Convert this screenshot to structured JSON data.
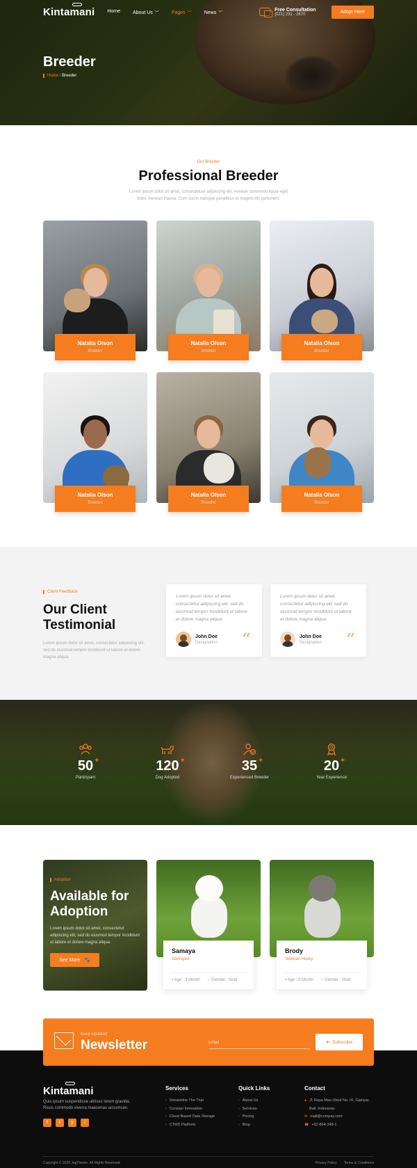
{
  "nav": {
    "logo": "Kintamani",
    "menu": [
      {
        "label": "Home",
        "dropdown": false,
        "active": false
      },
      {
        "label": "About Us",
        "dropdown": true,
        "active": false
      },
      {
        "label": "Pages",
        "dropdown": true,
        "active": true
      },
      {
        "label": "News",
        "dropdown": true,
        "active": false
      }
    ],
    "consult_title": "Free Consultation",
    "consult_phone": "(021) 231 - 2870",
    "cta": "Adopt Here"
  },
  "hero": {
    "title": "Breeder",
    "crumb_home": "Home",
    "crumb_current": "Breeder"
  },
  "breeder": {
    "eyebrow": "Our Breeder",
    "title": "Professional Breeder",
    "subtitle": "Lorem ipsum dolor sit amet, consectetuer adipiscing elit. Aenean commodo ligula eget dolor. Aenean massa. Cum sociis natoque penatibus et magnis dis parturient.",
    "cards": [
      {
        "name": "Natalia Olson",
        "role": "Breeder"
      },
      {
        "name": "Natalia Olson",
        "role": "Breeder"
      },
      {
        "name": "Natalia Olson",
        "role": "Breeder"
      },
      {
        "name": "Natalia Olson",
        "role": "Breeder"
      },
      {
        "name": "Natalia Olson",
        "role": "Breeder"
      },
      {
        "name": "Natalia Olson",
        "role": "Breeder"
      }
    ]
  },
  "testimonial": {
    "eyebrow": "Client Feedback",
    "title_line1": "Our Client",
    "title_line2": "Testimonial",
    "text": "Lorem ipsum dolor sit amet, consectetur adipiscing elit, sed do eiusmod tempor incididunt ut labore et dolore magna aliqua.",
    "cards": [
      {
        "quote": "Lorem ipsum dolor sit amet, consectetur adipiscing elit, sed do eiusmod tempor incididunt ut labore et dolore magna aliqua.",
        "name": "John Doe",
        "designation": "Designation"
      },
      {
        "quote": "Lorem ipsum dolor sit amet, consectetur adipiscing elit, sed do eiusmod tempor incididunt ut labore et dolore magna aliqua.",
        "name": "John Doe",
        "designation": "Designation"
      }
    ]
  },
  "stats": [
    {
      "value": "50",
      "label": "Participant",
      "icon": "people-icon"
    },
    {
      "value": "120",
      "label": "Dog Adopted",
      "icon": "dog-icon"
    },
    {
      "value": "35",
      "label": "Experienced Breeder",
      "icon": "breeder-badge-icon"
    },
    {
      "value": "20",
      "label": "Year Experience",
      "icon": "award-ribbon-icon"
    }
  ],
  "stats_suffix": "+",
  "adoption": {
    "eyebrow": "Adoption",
    "title": "Available for Adoption",
    "text": "Lorem ipsum dolor sit amet, consectetur adipiscing elit, sed do eiusmod tempor incididunt ut labore et dolore magna aliqua",
    "button": "See More",
    "pets": [
      {
        "name": "Samaya",
        "breed": "Samoyed",
        "age": "Age : 3 Month",
        "gender": "Gender : Stud"
      },
      {
        "name": "Brody",
        "breed": "Siberian Husky",
        "age": "Age : 3 Month",
        "gender": "Gender : Stud"
      }
    ]
  },
  "newsletter": {
    "kicker": "Keep Updated",
    "title": "Newsletter",
    "placeholder": "Email",
    "button": "Subscribe"
  },
  "footer": {
    "logo": "Kintamani",
    "desc": "Quis ipsum suspendisse ultrices lorem gravida. Risus commodo viverra maecenas accumsan.",
    "socials": [
      "f",
      "t",
      "y",
      "i"
    ],
    "services_title": "Services",
    "services": [
      "Streamline The Trial",
      "Constan Innovation",
      "Cloud Based Data Storage",
      "CTMS Platform"
    ],
    "links_title": "Quick Links",
    "links": [
      "About Us",
      "Services",
      "Pricing",
      "Blog"
    ],
    "contact_title": "Contact",
    "address": "Jl. Raya Mas Ubud No. IX, Gianyar, Bali, Indonesia.",
    "email": "mail@compay.com",
    "phone": "+62-864-349-1",
    "copyright": "Copyright © 2020 JegTheme. All Rights Reserved.",
    "privacy": "Privacy Policy",
    "terms": "Terms & Conditions"
  },
  "colors": {
    "accent": "#f57c1f",
    "dark": "#0d0d0d",
    "light_bg": "#f3f3f3"
  }
}
